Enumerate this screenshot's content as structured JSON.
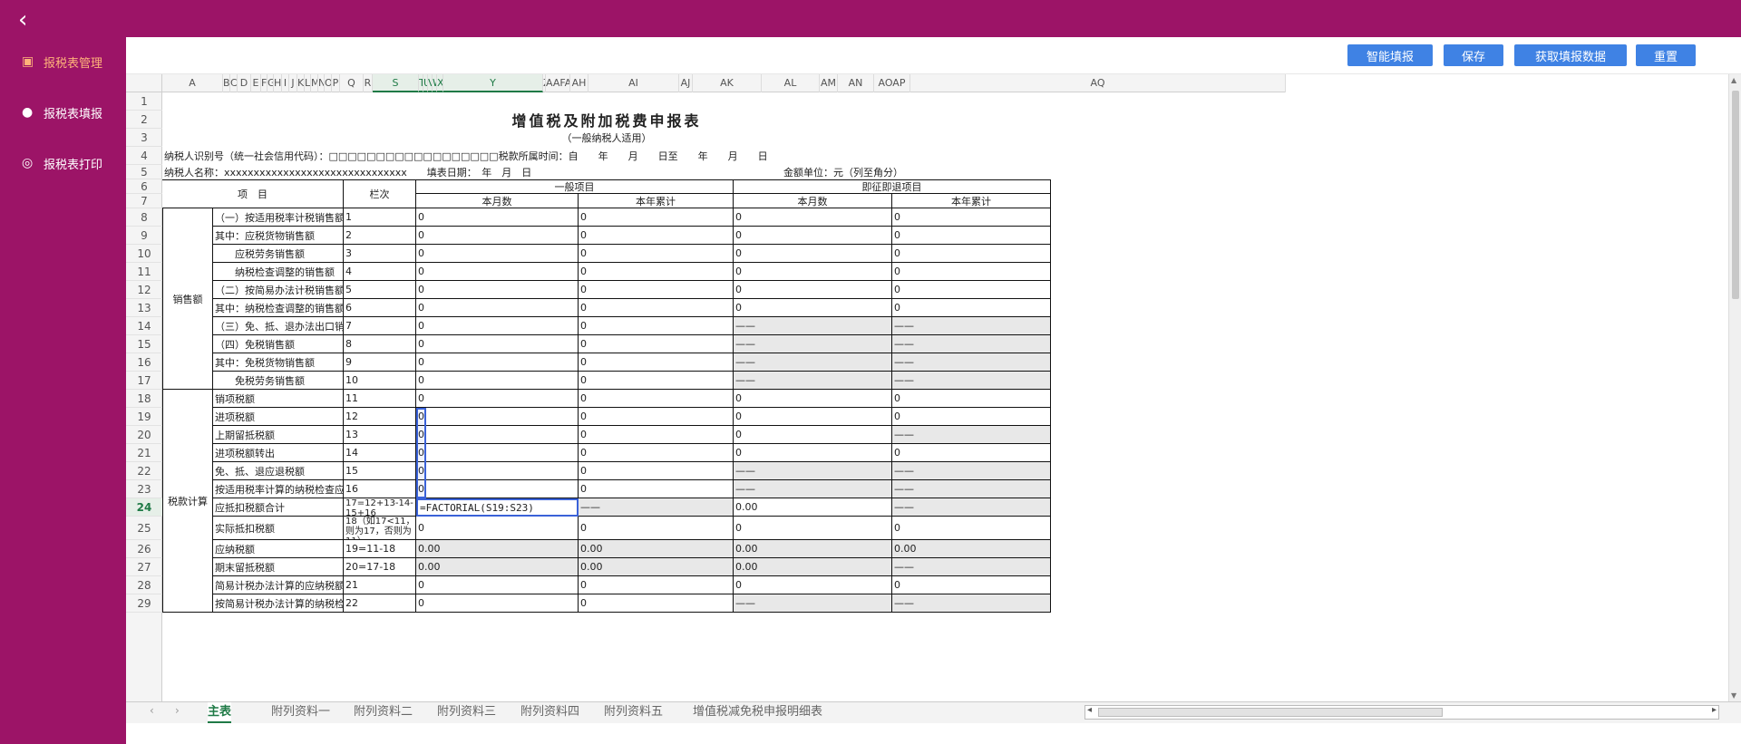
{
  "sidebar": {
    "back_icon": "chevron-left-icon",
    "items": [
      {
        "label": "报税表管理",
        "icon": "form-manage-icon",
        "active": true
      },
      {
        "label": "报税表填报",
        "icon": "user-icon",
        "active": false
      },
      {
        "label": "报税表打印",
        "icon": "print-icon",
        "active": false
      }
    ]
  },
  "toolbar": {
    "smart_fill": "智能填报",
    "save": "保存",
    "fetch": "获取填报数据",
    "reset": "重置"
  },
  "columns": [
    "A",
    "B",
    "C",
    "D",
    "E",
    "F",
    "G",
    "H",
    "I",
    "J",
    "K",
    "L",
    "M",
    "N",
    "O",
    "P",
    "Q",
    "R",
    "S",
    "T",
    "U",
    "V",
    "W",
    "X",
    "Y",
    "Z",
    "AAFAG",
    "AH",
    "AI",
    "AJ",
    "AK",
    "AL",
    "AM",
    "AN",
    "AOAP",
    "AQ"
  ],
  "rows": [
    "1",
    "2",
    "3",
    "4",
    "5",
    "6",
    "7",
    "8",
    "9",
    "10",
    "11",
    "12",
    "13",
    "14",
    "15",
    "16",
    "17",
    "18",
    "19",
    "20",
    "21",
    "22",
    "23",
    "24",
    "25",
    "26",
    "27",
    "28",
    "29"
  ],
  "form": {
    "title": "增值税及附加税费申报表",
    "subtitle": "（一般纳税人适用）",
    "taxpayer_id": "纳税人识别号（统一社会信用代码）：□□□□□□□□□□□□□□□□□□税款所属时间：自　　年　　月　　日至　　年　　月　　日",
    "taxpayer_name": "纳税人名称：xxxxxxxxxxxxxxxxxxxxxxxxxxxxxxx　　填表日期：　年　月　日",
    "unit": "金额单位：元（列至角分）"
  },
  "headers": {
    "item": "项　目",
    "col_no": "栏次",
    "general": "一般项目",
    "immediate": "即征即退项目",
    "month": "本月数",
    "year": "本年累计"
  },
  "groups": {
    "sales": "销售额",
    "tax_calc": "税款计算"
  },
  "table_rows": [
    {
      "item": "（一）按适用税率计税销售额",
      "no": "1",
      "v": [
        "0",
        "0",
        "0",
        "0"
      ]
    },
    {
      "item": "其中：应税货物销售额",
      "no": "2",
      "v": [
        "0",
        "0",
        "0",
        "0"
      ]
    },
    {
      "item": "　　应税劳务销售额",
      "no": "3",
      "v": [
        "0",
        "0",
        "0",
        "0"
      ]
    },
    {
      "item": "　　纳税检查调整的销售额",
      "no": "4",
      "v": [
        "0",
        "0",
        "0",
        "0"
      ]
    },
    {
      "item": "（二）按简易办法计税销售额",
      "no": "5",
      "v": [
        "0",
        "0",
        "0",
        "0"
      ]
    },
    {
      "item": "其中：纳税检查调整的销售额",
      "no": "6",
      "v": [
        "0",
        "0",
        "0",
        "0"
      ]
    },
    {
      "item": "（三）免、抵、退办法出口销售额",
      "no": "7",
      "v": [
        "0",
        "0",
        "——",
        "——"
      ]
    },
    {
      "item": "（四）免税销售额",
      "no": "8",
      "v": [
        "0",
        "0",
        "——",
        "——"
      ]
    },
    {
      "item": "其中：免税货物销售额",
      "no": "9",
      "v": [
        "0",
        "0",
        "——",
        "——"
      ]
    },
    {
      "item": "　　免税劳务销售额",
      "no": "10",
      "v": [
        "0",
        "0",
        "——",
        "——"
      ]
    },
    {
      "item": "销项税额",
      "no": "11",
      "v": [
        "0",
        "0",
        "0",
        "0"
      ]
    },
    {
      "item": "进项税额",
      "no": "12",
      "v": [
        "0",
        "0",
        "0",
        "0"
      ]
    },
    {
      "item": "上期留抵税额",
      "no": "13",
      "v": [
        "0",
        "0",
        "0",
        "——"
      ]
    },
    {
      "item": "进项税额转出",
      "no": "14",
      "v": [
        "0",
        "0",
        "0",
        "0"
      ]
    },
    {
      "item": "免、抵、退应退税额",
      "no": "15",
      "v": [
        "0",
        "0",
        "——",
        "——"
      ]
    },
    {
      "item": "按适用税率计算的纳税检查应补缴税额",
      "no": "16",
      "v": [
        "0",
        "0",
        "——",
        "——"
      ]
    },
    {
      "item": "应抵扣税额合计",
      "no": "17=12+13-14-15+16",
      "v": [
        "=FACTORIAL(S19:S23)",
        "——",
        "0.00",
        "——"
      ]
    },
    {
      "item": "实际抵扣税额",
      "no": "18（如17<11，则为17，否则为11）",
      "v": [
        "0",
        "0",
        "0",
        "0"
      ]
    },
    {
      "item": "应纳税额",
      "no": "19=11-18",
      "v": [
        "0.00",
        "0.00",
        "0.00",
        "0.00"
      ]
    },
    {
      "item": "期末留抵税额",
      "no": "20=17-18",
      "v": [
        "0.00",
        "0.00",
        "0.00",
        "——"
      ]
    },
    {
      "item": "简易计税办法计算的应纳税额",
      "no": "21",
      "v": [
        "0",
        "0",
        "0",
        "0"
      ]
    },
    {
      "item": "按简易计税办法计算的纳税检查应补缴税额",
      "no": "22",
      "v": [
        "0",
        "0",
        "——",
        "——"
      ]
    }
  ],
  "sheet_tabs": [
    "主表",
    "附列资料一",
    "附列资料二",
    "附列资料三",
    "附列资料四",
    "附列资料五",
    "增值税减免税申报明细表"
  ],
  "active_tab": "主表",
  "selected_cell": "S24",
  "colors": {
    "brand": "#9c1467",
    "button": "#3f82e4",
    "active_nav": "#ffb37a",
    "selection": "#3a62d8"
  }
}
